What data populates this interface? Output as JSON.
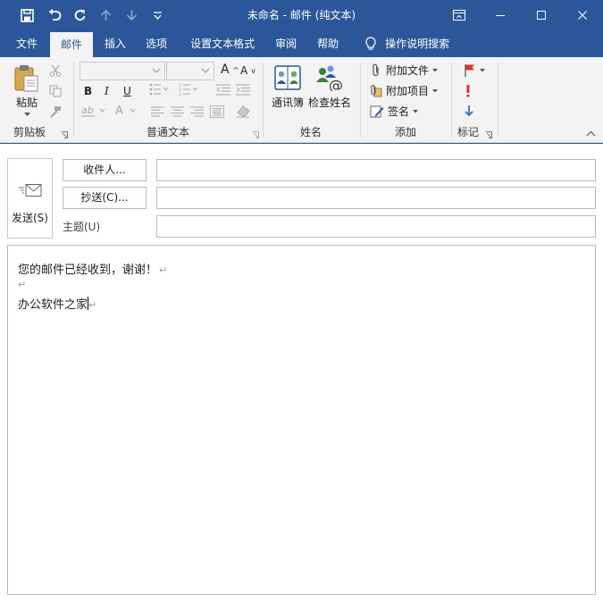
{
  "window": {
    "title": "未命名  -  邮件 (纯文本)"
  },
  "qat": {
    "save_icon": "save-icon",
    "undo_icon": "undo-icon",
    "redo_icon": "redo-icon",
    "up_icon": "arrow-up-icon",
    "down_icon": "arrow-down-icon",
    "customize_icon": "customize-qat-icon"
  },
  "tabs": [
    {
      "label": "文件"
    },
    {
      "label": "邮件"
    },
    {
      "label": "插入"
    },
    {
      "label": "选项"
    },
    {
      "label": "设置文本格式"
    },
    {
      "label": "审阅"
    },
    {
      "label": "帮助"
    },
    {
      "label": "操作说明搜索"
    }
  ],
  "ribbon": {
    "clipboard": {
      "paste": "粘贴",
      "label": "剪贴板"
    },
    "basic_text": {
      "label": "普通文本"
    },
    "names": {
      "address_book": "通讯簿",
      "check_names": "检查姓名",
      "label": "姓名"
    },
    "include": {
      "attach_file": "附加文件",
      "attach_item": "附加项目",
      "signature": "签名",
      "label": "添加"
    },
    "tags": {
      "label": "标记"
    }
  },
  "compose": {
    "send": "发送(S)",
    "to": "收件人...",
    "cc": "抄送(C)...",
    "subject_label": "主题(U)",
    "to_value": "",
    "cc_value": "",
    "subject_value": "",
    "body_lines": [
      "您的邮件已经收到，谢谢！",
      "",
      "办公软件之家"
    ]
  },
  "colors": {
    "accent": "#2b579a",
    "ribbon_bg": "#f3f3f3",
    "flag_red": "#e0312e",
    "arrow_blue": "#2b74c7"
  }
}
